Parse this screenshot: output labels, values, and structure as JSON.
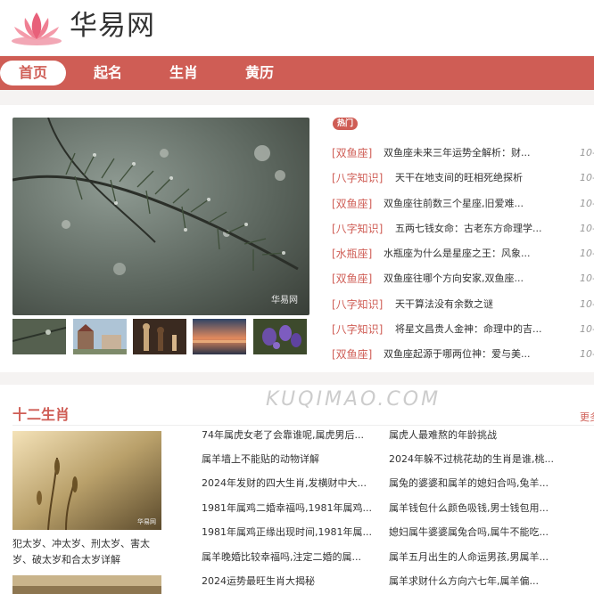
{
  "header": {
    "logo_text": "华易网"
  },
  "nav": {
    "items": [
      "首页",
      "起名",
      "生肖",
      "黄历"
    ]
  },
  "hero": {
    "caption_mark": "华易网"
  },
  "hot": {
    "badge": "热门",
    "items": [
      {
        "tag": "[双鱼座]",
        "title": "双鱼座未来三年运势全解析：财...",
        "date": "10-"
      },
      {
        "tag": "[八字知识]",
        "title": "天干在地支间的旺相死绝探析",
        "date": "10-"
      },
      {
        "tag": "[双鱼座]",
        "title": "双鱼座往前数三个星座,旧爱难...",
        "date": "10-"
      },
      {
        "tag": "[八字知识]",
        "title": "五两七钱女命：古老东方命理学...",
        "date": "10-"
      },
      {
        "tag": "[水瓶座]",
        "title": "水瓶座为什么是星座之王：风象...",
        "date": "10-"
      },
      {
        "tag": "[双鱼座]",
        "title": "双鱼座往哪个方向安家,双鱼座...",
        "date": "10-"
      },
      {
        "tag": "[八字知识]",
        "title": "天干算法没有余数之谜",
        "date": "10-"
      },
      {
        "tag": "[八字知识]",
        "title": "将星文昌贵人金神：命理中的吉...",
        "date": "10-"
      },
      {
        "tag": "[双鱼座]",
        "title": "双鱼座起源于哪两位神：爱与美...",
        "date": "10-"
      }
    ]
  },
  "watermark": "KUQIMAO.COM",
  "zodiac": {
    "title": "十二生肖",
    "more": "更多",
    "feature_caption": "犯太岁、冲太岁、刑太岁、害太岁、破太岁和合太岁详解",
    "col1": [
      "74年属虎女老了会靠谁呢,属虎男后...",
      "属羊墙上不能贴的动物详解",
      "2024年发财的四大生肖,发横财中大...",
      "1981年属鸡二婚幸福吗,1981年属鸡...",
      "1981年属鸡正缘出现时间,1981年属...",
      "属羊晚婚比较幸福吗,注定二婚的属...",
      "2024运势最旺生肖大揭秘"
    ],
    "col2": [
      "属虎人最难熬的年龄挑战",
      "2024年躲不过桃花劫的生肖是谁,桃...",
      "属兔的婆婆和属羊的媳妇合吗,兔羊...",
      "属羊钱包什么颜色吸钱,男士钱包用...",
      "媳妇属牛婆婆属兔合吗,属牛不能吃...",
      "属羊五月出生的人命运男孩,男属羊...",
      "属羊求财什么方向六七年,属羊偏..."
    ]
  }
}
